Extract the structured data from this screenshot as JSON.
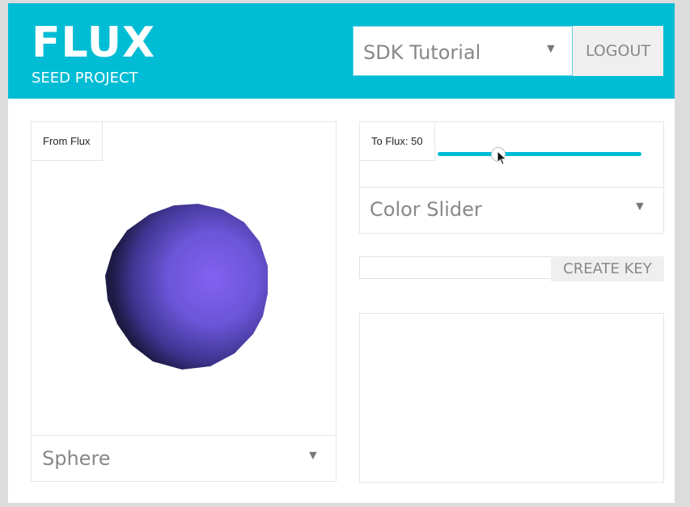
{
  "header": {
    "title": "FLUX",
    "subtitle": "SEED PROJECT",
    "project_select": {
      "value": "SDK Tutorial",
      "caret": "▼"
    },
    "logout_label": "LOGOUT"
  },
  "left_panel": {
    "label": "From Flux",
    "viewport_object": "sphere",
    "shape_select": {
      "value": "Sphere",
      "caret": "▼"
    }
  },
  "right_panel": {
    "slider": {
      "label": "To Flux: 50",
      "value": 50,
      "min": 0,
      "max": 100
    },
    "color_select": {
      "value": "Color Slider",
      "caret": "▼"
    },
    "key_input": {
      "value": "",
      "placeholder": ""
    },
    "create_key_label": "CREATE KEY",
    "textarea": {
      "value": ""
    }
  },
  "colors": {
    "accent": "#00bcd4",
    "sphere": "#6b55d8",
    "button_bg": "#efefef",
    "muted_text": "#888888"
  },
  "icons": [
    "caret-down-icon",
    "mouse-cursor-icon",
    "resize-grip-icon"
  ]
}
